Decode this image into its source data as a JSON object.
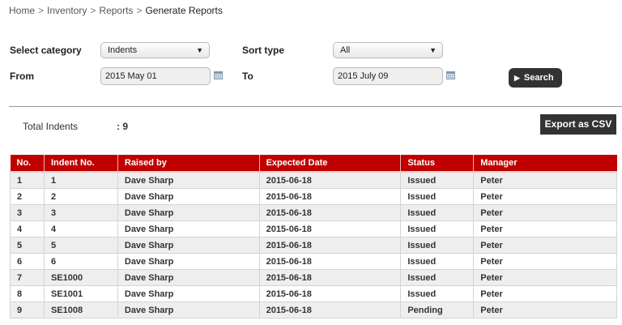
{
  "breadcrumb": [
    "Home",
    "Inventory",
    "Reports",
    "Generate Reports"
  ],
  "filters": {
    "category_label": "Select category",
    "category_value": "Indents",
    "sort_label": "Sort type",
    "sort_value": "All",
    "from_label": "From",
    "from_value": "2015 May 01",
    "to_label": "To",
    "to_value": "2015 July 09",
    "search_label": "Search"
  },
  "summary": {
    "total_label": "Total Indents",
    "total_value": ": 9",
    "export_label": "Export as CSV"
  },
  "table": {
    "headers": [
      "No.",
      "Indent No.",
      "Raised by",
      "Expected Date",
      "Status",
      "Manager"
    ],
    "rows": [
      [
        "1",
        "1",
        "Dave Sharp",
        "2015-06-18",
        "Issued",
        "Peter"
      ],
      [
        "2",
        "2",
        "Dave Sharp",
        "2015-06-18",
        "Issued",
        "Peter"
      ],
      [
        "3",
        "3",
        "Dave Sharp",
        "2015-06-18",
        "Issued",
        "Peter"
      ],
      [
        "4",
        "4",
        "Dave Sharp",
        "2015-06-18",
        "Issued",
        "Peter"
      ],
      [
        "5",
        "5",
        "Dave Sharp",
        "2015-06-18",
        "Issued",
        "Peter"
      ],
      [
        "6",
        "6",
        "Dave Sharp",
        "2015-06-18",
        "Issued",
        "Peter"
      ],
      [
        "7",
        "SE1000",
        "Dave Sharp",
        "2015-06-18",
        "Issued",
        "Peter"
      ],
      [
        "8",
        "SE1001",
        "Dave Sharp",
        "2015-06-18",
        "Issued",
        "Peter"
      ],
      [
        "9",
        "SE1008",
        "Dave Sharp",
        "2015-06-18",
        "Pending",
        "Peter"
      ]
    ]
  },
  "colors": {
    "header_red": "#c00000",
    "button_dark": "#333333",
    "row_stripe": "#eeeeee"
  }
}
